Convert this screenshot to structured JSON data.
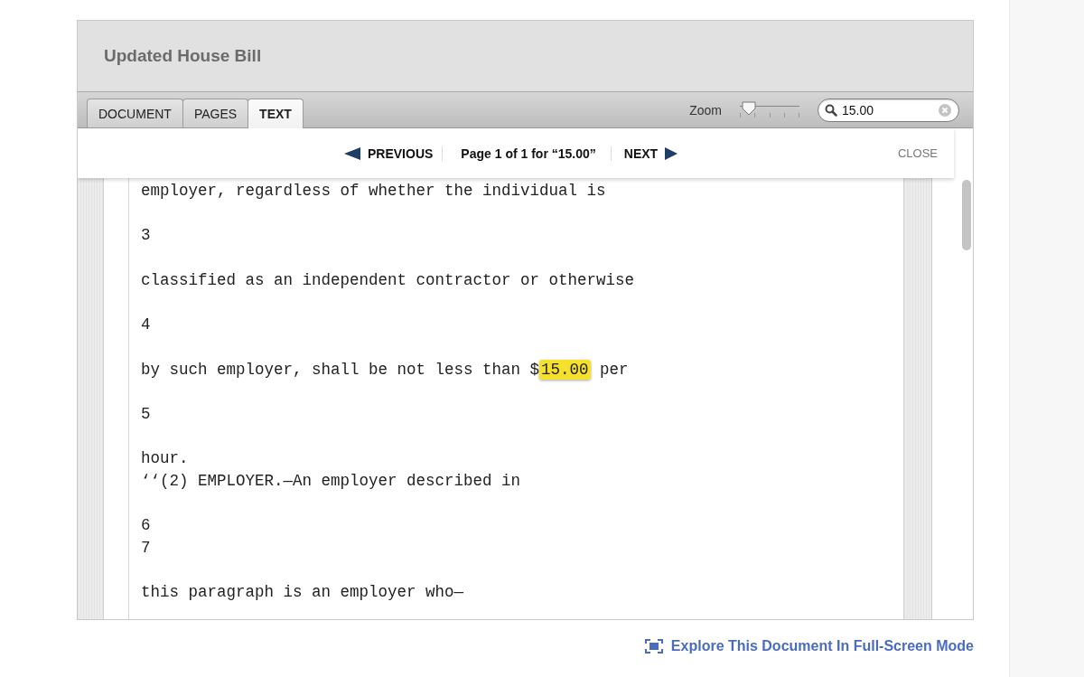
{
  "title": "Updated House Bill",
  "tabs": [
    {
      "label": "DOCUMENT",
      "selected": false
    },
    {
      "label": "PAGES",
      "selected": false
    },
    {
      "label": "TEXT",
      "selected": true
    }
  ],
  "zoom": {
    "label": "Zoom",
    "level": 0.15
  },
  "search": {
    "value": "15.00"
  },
  "find_bar": {
    "previous": "PREVIOUS",
    "status": "Page 1 of 1 for “15.00”",
    "next": "NEXT",
    "close": "CLOSE"
  },
  "document": {
    "blocks": [
      {
        "lines": [
          {
            "segments": [
              {
                "text": "employer, regardless of whether the individual is",
                "highlighted": false
              }
            ]
          }
        ]
      },
      {
        "lines": [
          {
            "segments": [
              {
                "text": "3",
                "highlighted": false
              }
            ]
          }
        ]
      },
      {
        "lines": [
          {
            "segments": [
              {
                "text": "classified as an independent contractor or otherwise",
                "highlighted": false
              }
            ]
          }
        ]
      },
      {
        "lines": [
          {
            "segments": [
              {
                "text": "4",
                "highlighted": false
              }
            ]
          }
        ]
      },
      {
        "lines": [
          {
            "segments": [
              {
                "text": "by such employer, shall be not less than $",
                "highlighted": false
              },
              {
                "text": "15.00",
                "highlighted": true
              },
              {
                "text": " per",
                "highlighted": false
              }
            ]
          }
        ]
      },
      {
        "lines": [
          {
            "segments": [
              {
                "text": "5",
                "highlighted": false
              }
            ]
          }
        ]
      },
      {
        "lines": [
          {
            "segments": [
              {
                "text": "hour.",
                "highlighted": false
              }
            ]
          },
          {
            "segments": [
              {
                "text": "‘‘(2) EMPLOYER.—An employer described in",
                "highlighted": false
              }
            ]
          }
        ]
      },
      {
        "lines": [
          {
            "segments": [
              {
                "text": "6",
                "highlighted": false
              }
            ]
          },
          {
            "segments": [
              {
                "text": "7",
                "highlighted": false
              }
            ]
          }
        ]
      },
      {
        "lines": [
          {
            "segments": [
              {
                "text": "this paragraph is an employer who—",
                "highlighted": false
              }
            ]
          }
        ]
      }
    ]
  },
  "footer_link": "Explore This Document In Full-Screen Mode"
}
